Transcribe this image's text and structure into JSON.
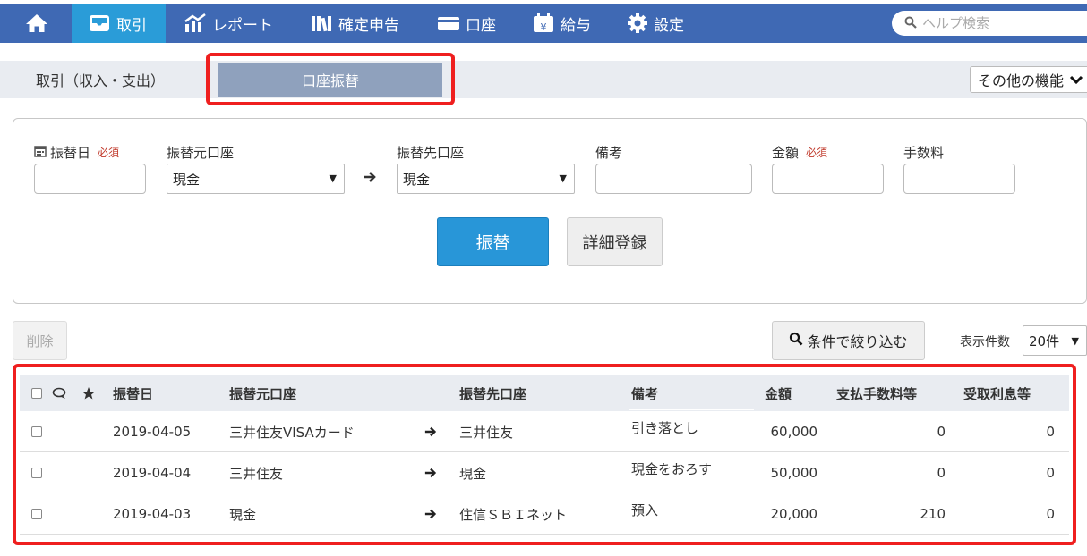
{
  "nav": {
    "items": [
      {
        "label": "",
        "icon": "home-icon"
      },
      {
        "label": "取引",
        "icon": "inbox-tray-icon"
      },
      {
        "label": "レポート",
        "icon": "bar-chart-icon"
      },
      {
        "label": "確定申告",
        "icon": "books-icon"
      },
      {
        "label": "口座",
        "icon": "card-icon"
      },
      {
        "label": "給与",
        "icon": "calendar-yen-icon"
      },
      {
        "label": "設定",
        "icon": "gear-icon"
      }
    ],
    "search_placeholder": "ヘルプ検索"
  },
  "subnav": {
    "tab_income_expense": "取引（収入・支出）",
    "tab_transfer": "口座振替",
    "more_label": "その他の機能"
  },
  "form": {
    "date_label": "振替日",
    "required_mark": "必須",
    "from_label": "振替元口座",
    "from_value": "現金",
    "to_label": "振替先口座",
    "to_value": "現金",
    "note_label": "備考",
    "amount_label": "金額",
    "fee_label": "手数料",
    "submit_label": "振替",
    "detail_label": "詳細登録"
  },
  "list_controls": {
    "delete_label": "削除",
    "filter_label": "条件で絞り込む",
    "count_label": "表示件数",
    "count_value": "20件"
  },
  "table": {
    "headers": {
      "date": "振替日",
      "from": "振替元口座",
      "to": "振替先口座",
      "note": "備考",
      "amount": "金額",
      "fee": "支払手数料等",
      "interest": "受取利息等"
    },
    "rows": [
      {
        "date": "2019-04-05",
        "from": "三井住友VISAカード",
        "to": "三井住友",
        "note": "引き落とし",
        "amount": "60,000",
        "fee": "0",
        "interest": "0"
      },
      {
        "date": "2019-04-04",
        "from": "三井住友",
        "to": "現金",
        "note": "現金をおろす",
        "amount": "50,000",
        "fee": "0",
        "interest": "0"
      },
      {
        "date": "2019-04-03",
        "from": "現金",
        "to": "住信ＳＢＩネット",
        "note": "預入",
        "amount": "20,000",
        "fee": "210",
        "interest": "0"
      }
    ]
  },
  "colors": {
    "nav_bg": "#3f69b4",
    "nav_active": "#2a9cd8",
    "primary_button": "#2896d8",
    "highlight_frame": "#ef1f1f"
  }
}
